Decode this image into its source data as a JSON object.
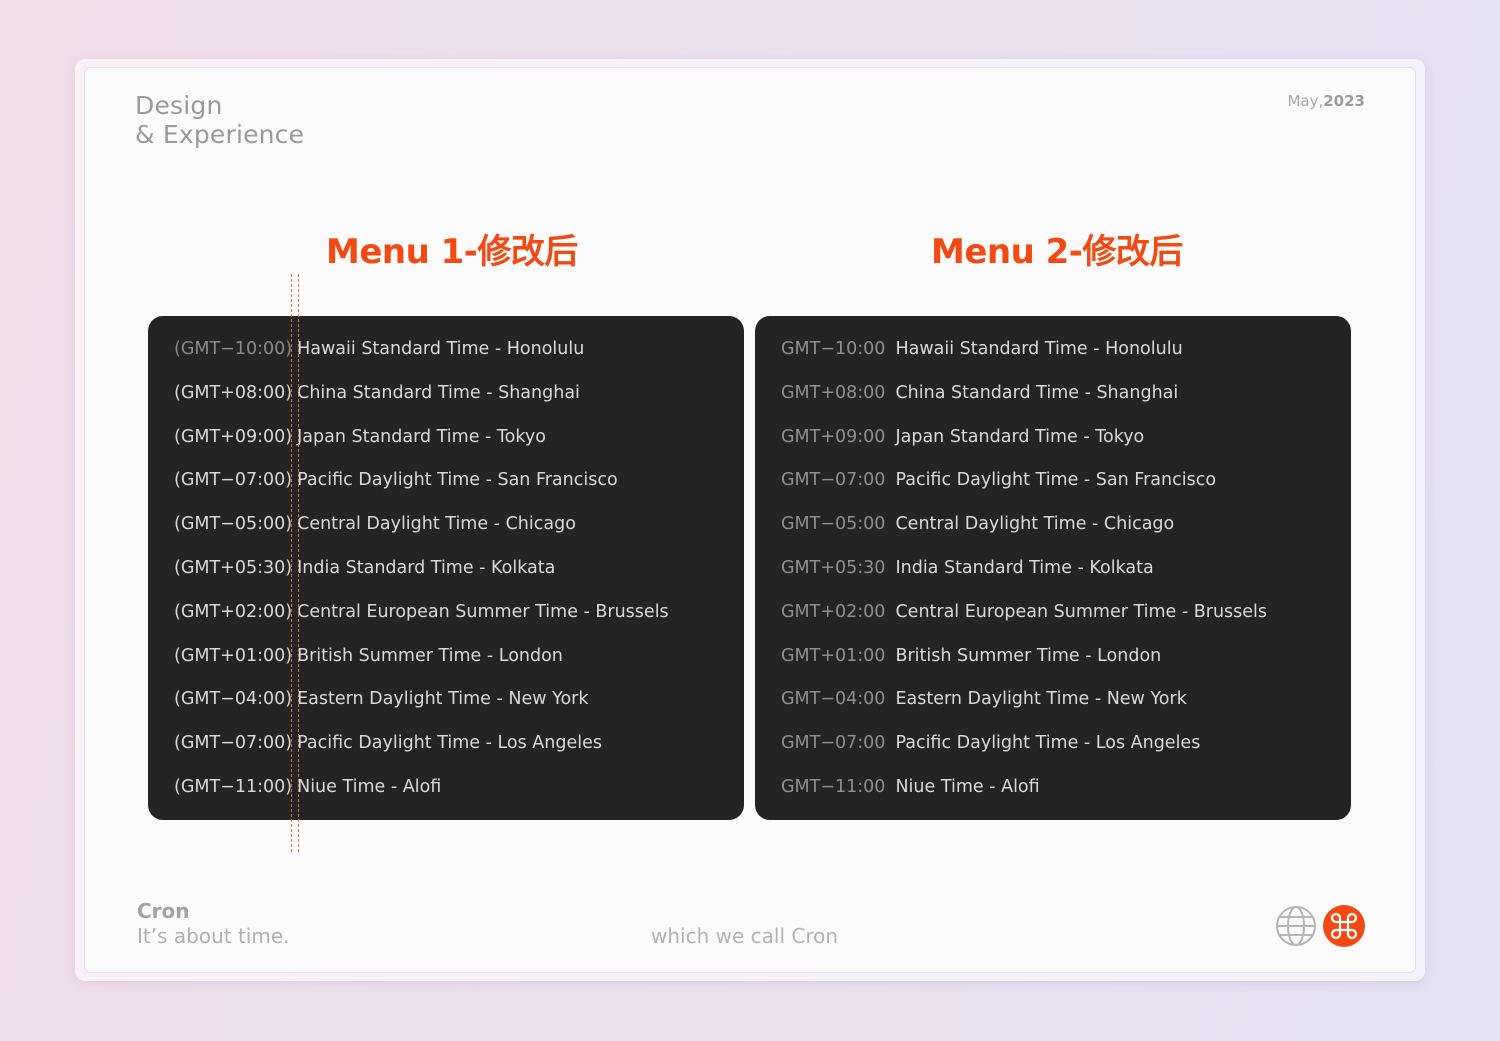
{
  "header": {
    "brand_line1": "Design",
    "brand_line2": "& Experience",
    "date_month": "May,",
    "date_year": "2023"
  },
  "menu1": {
    "title": "Menu 1-修改后",
    "rows": [
      {
        "offset": "(GMT−10:00)",
        "zone": "Hawaii Standard Time - Honolulu"
      },
      {
        "offset": "(GMT+08:00)",
        "zone": "China Standard Time - Shanghai"
      },
      {
        "offset": "(GMT+09:00)",
        "zone": "Japan Standard Time - Tokyo"
      },
      {
        "offset": "(GMT−07:00)",
        "zone": "Pacific Daylight Time - San Francisco"
      },
      {
        "offset": "(GMT−05:00)",
        "zone": "Central Daylight Time - Chicago"
      },
      {
        "offset": "(GMT+05:30)",
        "zone": "India Standard Time - Kolkata"
      },
      {
        "offset": "(GMT+02:00)",
        "zone": "Central European Summer Time - Brussels"
      },
      {
        "offset": "(GMT+01:00)",
        "zone": "British Summer Time - London"
      },
      {
        "offset": "(GMT−04:00)",
        "zone": "Eastern Daylight Time - New York"
      },
      {
        "offset": "(GMT−07:00)",
        "zone": "Pacific Daylight Time - Los Angeles"
      },
      {
        "offset": "(GMT−11:00)",
        "zone": "Niue Time - Alofi"
      }
    ]
  },
  "menu2": {
    "title": "Menu 2-修改后",
    "rows": [
      {
        "offset": "GMT−10:00",
        "zone": "Hawaii Standard Time - Honolulu"
      },
      {
        "offset": "GMT+08:00",
        "zone": "China Standard Time - Shanghai"
      },
      {
        "offset": "GMT+09:00",
        "zone": "Japan Standard Time - Tokyo"
      },
      {
        "offset": "GMT−07:00",
        "zone": "Pacific Daylight Time - San Francisco"
      },
      {
        "offset": "GMT−05:00",
        "zone": "Central Daylight Time - Chicago"
      },
      {
        "offset": "GMT+05:30",
        "zone": "India Standard Time - Kolkata"
      },
      {
        "offset": "GMT+02:00",
        "zone": "Central European Summer Time - Brussels"
      },
      {
        "offset": "GMT+01:00",
        "zone": "British Summer Time - London"
      },
      {
        "offset": "GMT−04:00",
        "zone": "Eastern Daylight Time - New York"
      },
      {
        "offset": "GMT−07:00",
        "zone": "Pacific Daylight Time - Los Angeles"
      },
      {
        "offset": "GMT−11:00",
        "zone": "Niue Time - Alofi"
      }
    ]
  },
  "footer": {
    "name": "Cron",
    "tagline": "It’s about time.",
    "center": "which we call Cron"
  },
  "icons": {
    "globe": "globe-icon",
    "command": "command-icon"
  },
  "colors": {
    "accent": "#f24a12",
    "panel": "#242424"
  }
}
